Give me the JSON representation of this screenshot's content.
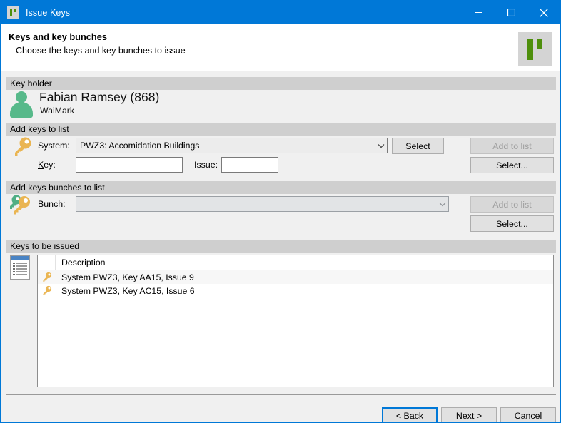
{
  "window": {
    "title": "Issue Keys",
    "app_icon": "app-logo-icon",
    "controls": {
      "minimize": "minimize-icon",
      "maximize": "maximize-icon",
      "close": "close-icon"
    }
  },
  "header": {
    "title": "Keys and key bunches",
    "subtitle": "Choose the keys and key bunches to issue",
    "logo": "brand-logo"
  },
  "key_holder": {
    "group_title": "Key holder",
    "name": "Fabian Ramsey (868)",
    "organisation": "WaiMark"
  },
  "add_keys": {
    "group_title": "Add keys to list",
    "system_label": "System:",
    "system_value": "PWZ3: Accomidation Buildings",
    "key_label_pre": "K",
    "key_label_accel": "K",
    "key_label": "Key:",
    "key_value": "",
    "issue_label": "Issue:",
    "issue_value": "",
    "select_button": "Select",
    "add_to_list_button": "Add to list",
    "select_dots_button": "Select..."
  },
  "add_bunches": {
    "group_title": "Add keys bunches to list",
    "bunch_label": "Bunch:",
    "bunch_value": "",
    "add_to_list_button": "Add to list",
    "select_dots_button": "Select..."
  },
  "keys_to_be_issued": {
    "group_title": "Keys to be issued",
    "columns": [
      "Description"
    ],
    "rows": [
      {
        "icon": "key-icon",
        "description": "System PWZ3, Key AA15, Issue 9"
      },
      {
        "icon": "key-icon",
        "description": "System PWZ3, Key AC15, Issue 6"
      }
    ]
  },
  "footer": {
    "back_button": "< Back",
    "next_button": "Next >",
    "cancel_button": "Cancel"
  },
  "colors": {
    "titlebar": "#0078d7",
    "accent": "#0078d7",
    "brand_green": "#4e8f0c",
    "avatar_green": "#57b98a",
    "key_gold": "#eab552",
    "key_green": "#4fae84",
    "group_bar": "#cfcfcf"
  }
}
